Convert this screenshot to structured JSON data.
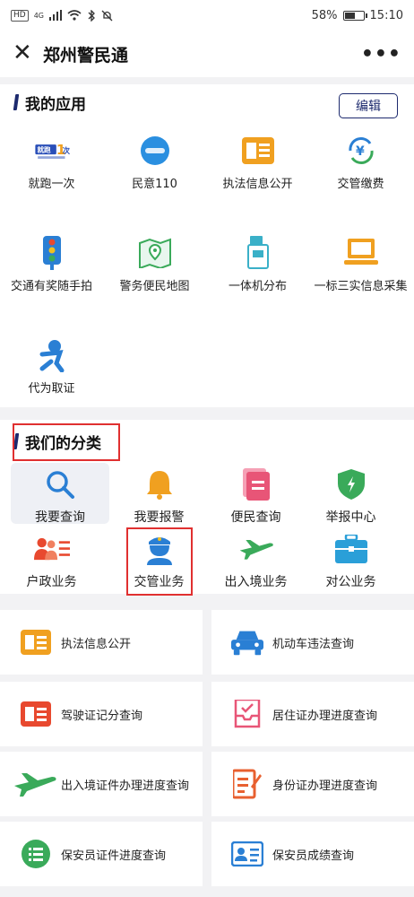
{
  "status_bar": {
    "hd": "HD",
    "signal": "4G",
    "battery": "58%",
    "battery_level": 0.58,
    "time": "15:10"
  },
  "title_bar": {
    "close_icon": "close-icon",
    "title": "郑州警民通",
    "more_icon": "more-dots-icon"
  },
  "my_apps": {
    "title": "我的应用",
    "edit_label": "编辑",
    "items": [
      {
        "label": "就跑一次",
        "icon": "jiupao-logo"
      },
      {
        "label": "民意110",
        "icon": "minyi-110-icon"
      },
      {
        "label": "执法信息公开",
        "icon": "law-info-card-icon"
      },
      {
        "label": "交管缴费",
        "icon": "yen-payment-icon"
      },
      {
        "label": "交通有奖随手拍",
        "icon": "traffic-light-icon"
      },
      {
        "label": "警务便民地图",
        "icon": "map-icon"
      },
      {
        "label": "一体机分布",
        "icon": "kiosk-icon"
      },
      {
        "label": "一标三实信息采集",
        "icon": "laptop-icon"
      },
      {
        "label": "代为取证",
        "icon": "running-person-icon"
      }
    ]
  },
  "categories": {
    "title": "我们的分类",
    "items": [
      {
        "label": "我要查询",
        "icon": "search-icon"
      },
      {
        "label": "我要报警",
        "icon": "bell-icon"
      },
      {
        "label": "便民查询",
        "icon": "document-icon"
      },
      {
        "label": "举报中心",
        "icon": "shield-icon"
      },
      {
        "label": "户政业务",
        "icon": "household-icon"
      },
      {
        "label": "交管业务",
        "icon": "police-officer-icon"
      },
      {
        "label": "出入境业务",
        "icon": "airplane-icon"
      },
      {
        "label": "对公业务",
        "icon": "briefcase-icon"
      }
    ]
  },
  "services": [
    {
      "label": "执法信息公开",
      "icon": "law-info-card-icon"
    },
    {
      "label": "机动车违法查询",
      "icon": "car-icon"
    },
    {
      "label": "驾驶证记分查询",
      "icon": "license-card-icon"
    },
    {
      "label": "居住证办理进度查询",
      "icon": "residence-tray-icon"
    },
    {
      "label": "出入境证件办理进度查询",
      "icon": "airplane-icon"
    },
    {
      "label": "身份证办理进度查询",
      "icon": "id-edit-icon"
    },
    {
      "label": "保安员证件进度查询",
      "icon": "list-circle-icon"
    },
    {
      "label": "保安员成绩查询",
      "icon": "id-card-icon"
    }
  ],
  "colors": {
    "brand_navy": "#1d2a6e",
    "orange": "#f0a020",
    "blue": "#2a7fd4",
    "green": "#3aaa5a",
    "red": "#e8492f",
    "pink": "#e85577",
    "highlight_red": "#e03030"
  }
}
